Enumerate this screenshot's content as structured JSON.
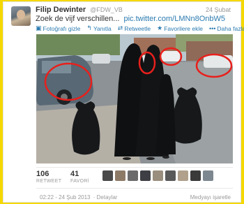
{
  "tweet": {
    "author_name": "Filip Dewinter",
    "author_handle": "@FDW_VB",
    "date": "24 Şubat",
    "text": "Zoek de vijf verschillen...",
    "link": "pic.twitter.com/LMNn8OnbW5"
  },
  "actions": [
    {
      "icon": "photo-icon",
      "glyph": "▣",
      "label": "Fotoğrafı gizle"
    },
    {
      "icon": "reply-icon",
      "glyph": "↰",
      "label": "Yanıtla"
    },
    {
      "icon": "retweet-icon",
      "glyph": "⇄",
      "label": "Retweetle"
    },
    {
      "icon": "star-icon",
      "glyph": "★",
      "label": "Favorilere ekle"
    },
    {
      "icon": "more-icon",
      "glyph": "•••",
      "label": "Daha fazla"
    }
  ],
  "stats": {
    "retweets": {
      "count": "106",
      "label": "RETWEET"
    },
    "favorites": {
      "count": "41",
      "label": "FAVORİ"
    }
  },
  "footer": {
    "timestamp": "02:22 - 24 Şub 2013",
    "details": "· Detaylar",
    "flag_media": "Medyayı işaretle"
  },
  "colors": {
    "background": "#f5d800",
    "link": "#2a7ab0",
    "annotation_circle": "#e8201c"
  }
}
